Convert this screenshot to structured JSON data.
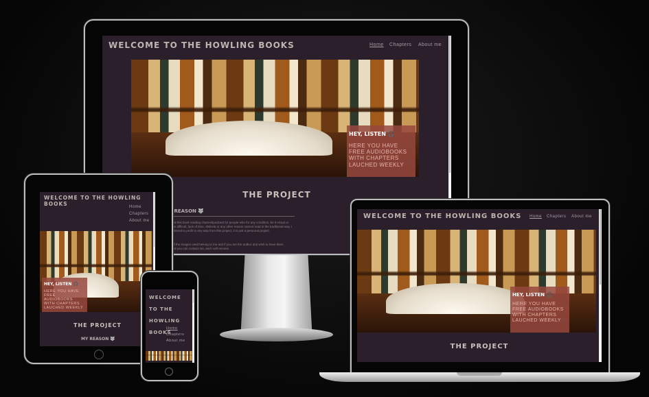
{
  "site": {
    "title": "Welcome to the Howling Books",
    "nav": [
      "Home",
      "Chapters",
      "About me"
    ],
    "callout_heading": "Hey, listen",
    "callout_icon": "headphones-icon",
    "callout_text": "Here you have free audiobooks with chapters lauched weekly",
    "project_title": "The Project",
    "reason_heading": "My reason",
    "reason_icon": "wolf-icon",
    "paragraph_1": "I created this book reading channel/podcast for people who for any condition, be it visual or attention difficult, lack of time, dislexia or any other reason cannot read in the traditional way. I do not intend to profit in any way from this project, it is just a personal project.",
    "paragraph_2": "None of the images used belong to me and if you are the author and wish to have them removed you can contact me, and I will remove"
  },
  "colors": {
    "background": "#2b1f2b",
    "callout": "#96483e",
    "frame": "#050505"
  }
}
